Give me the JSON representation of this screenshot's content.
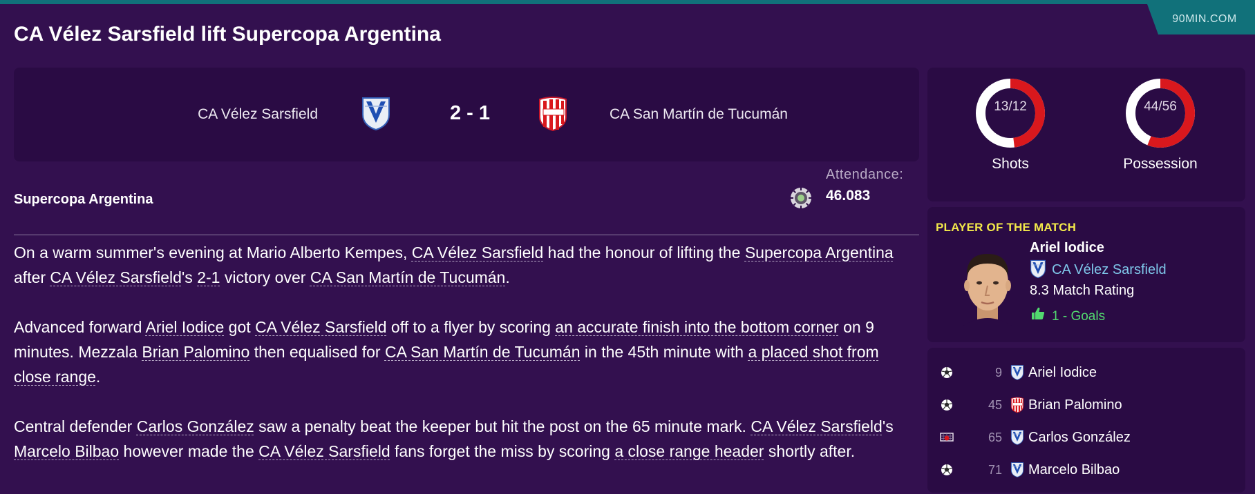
{
  "source_label": "90MIN.COM",
  "headline": "CA Vélez Sarsfield lift Supercopa Argentina",
  "match": {
    "home_team": "CA Vélez Sarsfield",
    "away_team": "CA San Martín de Tucumán",
    "score": "2 - 1",
    "home_crest_icon": "velez-crest-icon",
    "away_crest_icon": "san-martin-crest-icon"
  },
  "competition": "Supercopa Argentina",
  "attendance": {
    "label": "Attendance:",
    "value": "46.083",
    "icon": "stadium-icon"
  },
  "article": {
    "paragraphs": [
      [
        {
          "t": "On a warm summer's evening at Mario Alberto Kempes, "
        },
        {
          "t": "CA Vélez Sarsfield",
          "link": true
        },
        {
          "t": " had the honour of lifting the "
        },
        {
          "t": "Supercopa Argentina",
          "link": true
        },
        {
          "t": " after "
        },
        {
          "t": "CA Vélez Sarsfield",
          "link": true
        },
        {
          "t": "'s "
        },
        {
          "t": "2-1",
          "link": true
        },
        {
          "t": " victory over "
        },
        {
          "t": "CA San Martín de Tucumán",
          "link": true
        },
        {
          "t": "."
        }
      ],
      [
        {
          "t": "Advanced forward "
        },
        {
          "t": "Ariel Iodice",
          "link": true
        },
        {
          "t": " got "
        },
        {
          "t": "CA Vélez Sarsfield",
          "link": true
        },
        {
          "t": " off to a flyer by scoring "
        },
        {
          "t": "an accurate finish into the bottom corner",
          "link": true
        },
        {
          "t": " on 9 minutes. Mezzala "
        },
        {
          "t": "Brian Palomino",
          "link": true
        },
        {
          "t": " then equalised for "
        },
        {
          "t": "CA San Martín de Tucumán",
          "link": true
        },
        {
          "t": " in the 45th minute with "
        },
        {
          "t": "a placed shot from close range",
          "link": true
        },
        {
          "t": "."
        }
      ],
      [
        {
          "t": "Central defender "
        },
        {
          "t": "Carlos González",
          "link": true
        },
        {
          "t": " saw a penalty beat the keeper but hit the post on the 65 minute mark. "
        },
        {
          "t": "CA Vélez Sarsfield",
          "link": true
        },
        {
          "t": "'s "
        },
        {
          "t": "Marcelo Bilbao",
          "link": true
        },
        {
          "t": " however made the "
        },
        {
          "t": "CA Vélez Sarsfield",
          "link": true
        },
        {
          "t": " fans forget the miss by scoring "
        },
        {
          "t": "a close range header",
          "link": true
        },
        {
          "t": " shortly after."
        }
      ]
    ]
  },
  "stats": {
    "shots": {
      "label": "Shots",
      "text": "13/12",
      "home": 13,
      "away": 12
    },
    "possession": {
      "label": "Possession",
      "text": "44/56",
      "home": 44,
      "away": 56
    }
  },
  "player_of_match": {
    "title": "PLAYER OF THE MATCH",
    "name": "Ariel Iodice",
    "club": "CA Vélez Sarsfield",
    "rating": "8.3 Match Rating",
    "goals": "1 - Goals",
    "portrait_icon": "player-portrait",
    "goals_icon": "thumbs-up-icon"
  },
  "events": [
    {
      "minute": "9",
      "player": "Ariel Iodice",
      "icon": "goal-ball-icon",
      "team": "home"
    },
    {
      "minute": "45",
      "player": "Brian Palomino",
      "icon": "goal-ball-icon",
      "team": "away"
    },
    {
      "minute": "65",
      "player": "Carlos González",
      "icon": "missed-penalty-icon",
      "team": "home"
    },
    {
      "minute": "71",
      "player": "Marcelo Bilbao",
      "icon": "goal-ball-icon",
      "team": "home"
    }
  ],
  "colors": {
    "background": "#33104f",
    "panel": "#2a0b44",
    "accent_teal": "#11717a",
    "home_share": "#ffffff",
    "away_share": "#d9181d",
    "potm_title": "#f2e84a",
    "club_link": "#7fc7ea",
    "goals_green": "#52d96f"
  }
}
